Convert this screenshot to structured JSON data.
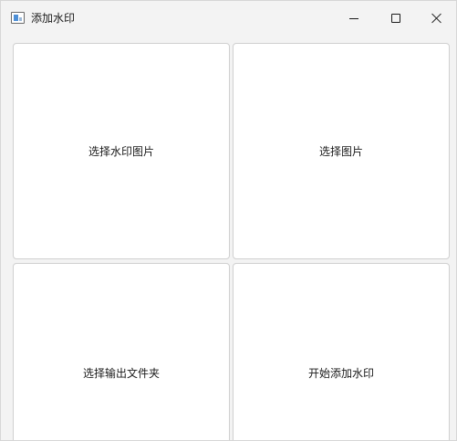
{
  "window": {
    "title": "添加水印",
    "icon": "app-window-icon",
    "controls": {
      "minimize": "minimize-icon",
      "maximize": "maximize-icon",
      "close": "close-icon"
    }
  },
  "buttons": {
    "select_watermark_image": "选择水印图片",
    "select_image": "选择图片",
    "select_output_folder": "选择输出文件夹",
    "start_watermark": "开始添加水印"
  }
}
